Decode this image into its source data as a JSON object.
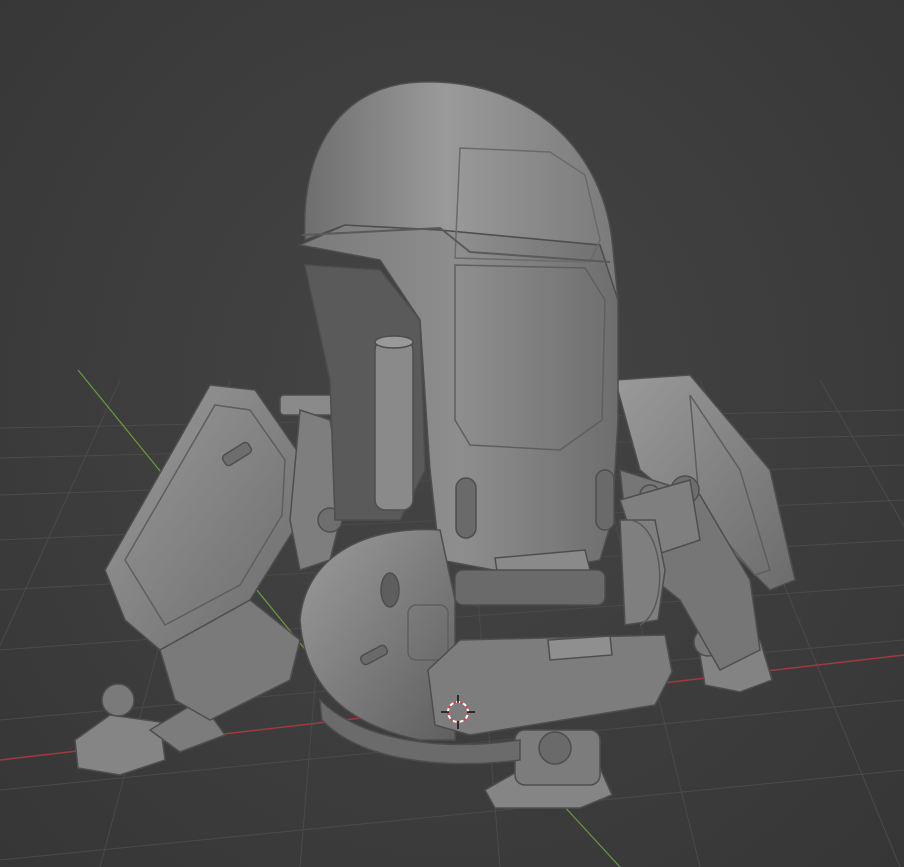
{
  "viewport": {
    "background_color": "#3d3d3d",
    "grid_line_color": "#4a4a4a",
    "x_axis_color": "#a03a3e",
    "y_axis_color": "#6a9a3a",
    "model_base_color": "#8c8c8c",
    "model_shadow_color": "#5e5e5e",
    "model_highlight_color": "#b4b4b4",
    "cursor_3d_color": "#e04040",
    "objects": [
      {
        "name": "robot-pod-model",
        "icon": "mesh-icon"
      },
      {
        "name": "3d-cursor",
        "icon": "crosshair-icon"
      }
    ]
  }
}
